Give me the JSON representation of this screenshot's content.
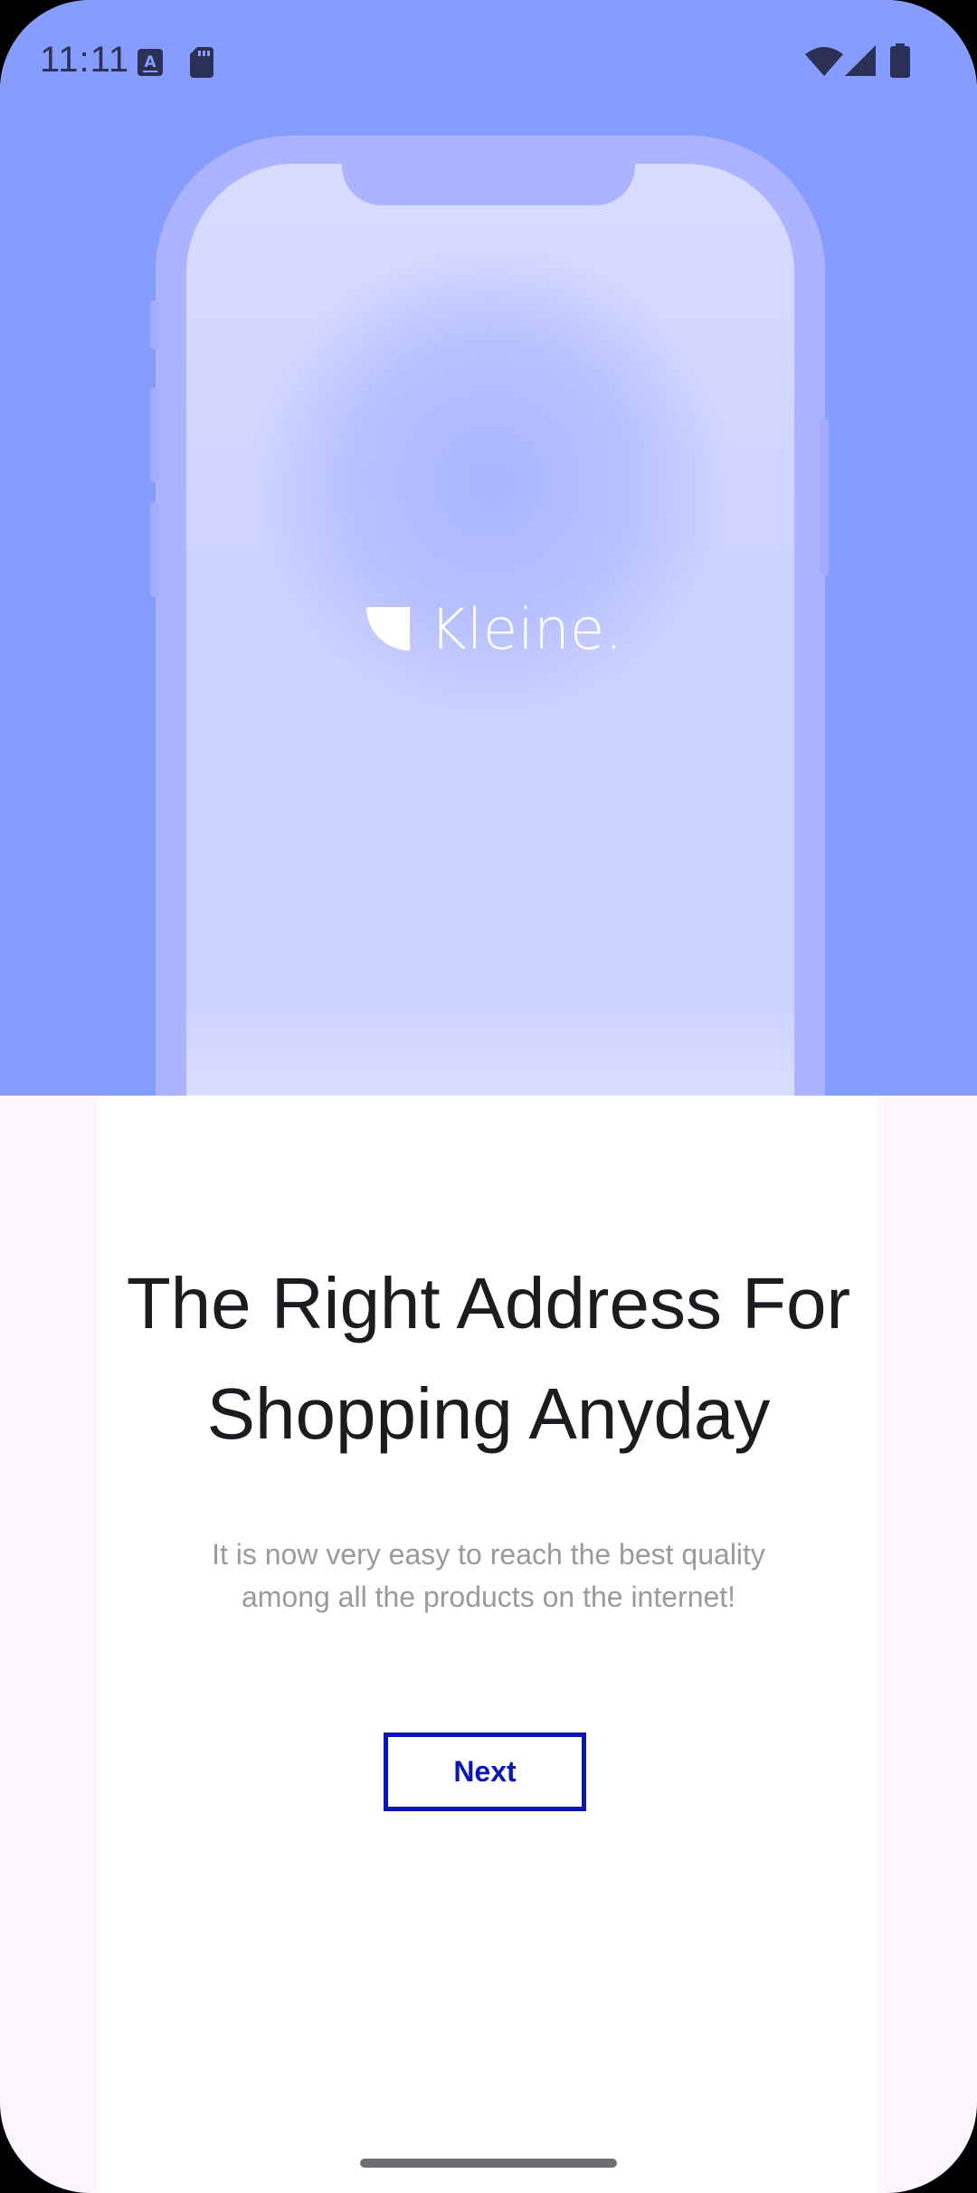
{
  "status_bar": {
    "time": "11:11",
    "icons": [
      "keyboard-a-icon",
      "sd-card-icon",
      "wifi-icon",
      "cell-signal-icon",
      "battery-icon"
    ]
  },
  "hero": {
    "brand_name": "Kleine.",
    "logo_icon": "quarter-circle-logo-icon",
    "background_color": "#869cff"
  },
  "onboarding": {
    "headline_line1": "The Right Address For",
    "headline_line2": "Shopping Anyday",
    "description_line1": "It is now very easy to reach the best quality",
    "description_line2": "among all the products on the internet!",
    "next_label": "Next",
    "accent_color": "#0b17b2"
  }
}
